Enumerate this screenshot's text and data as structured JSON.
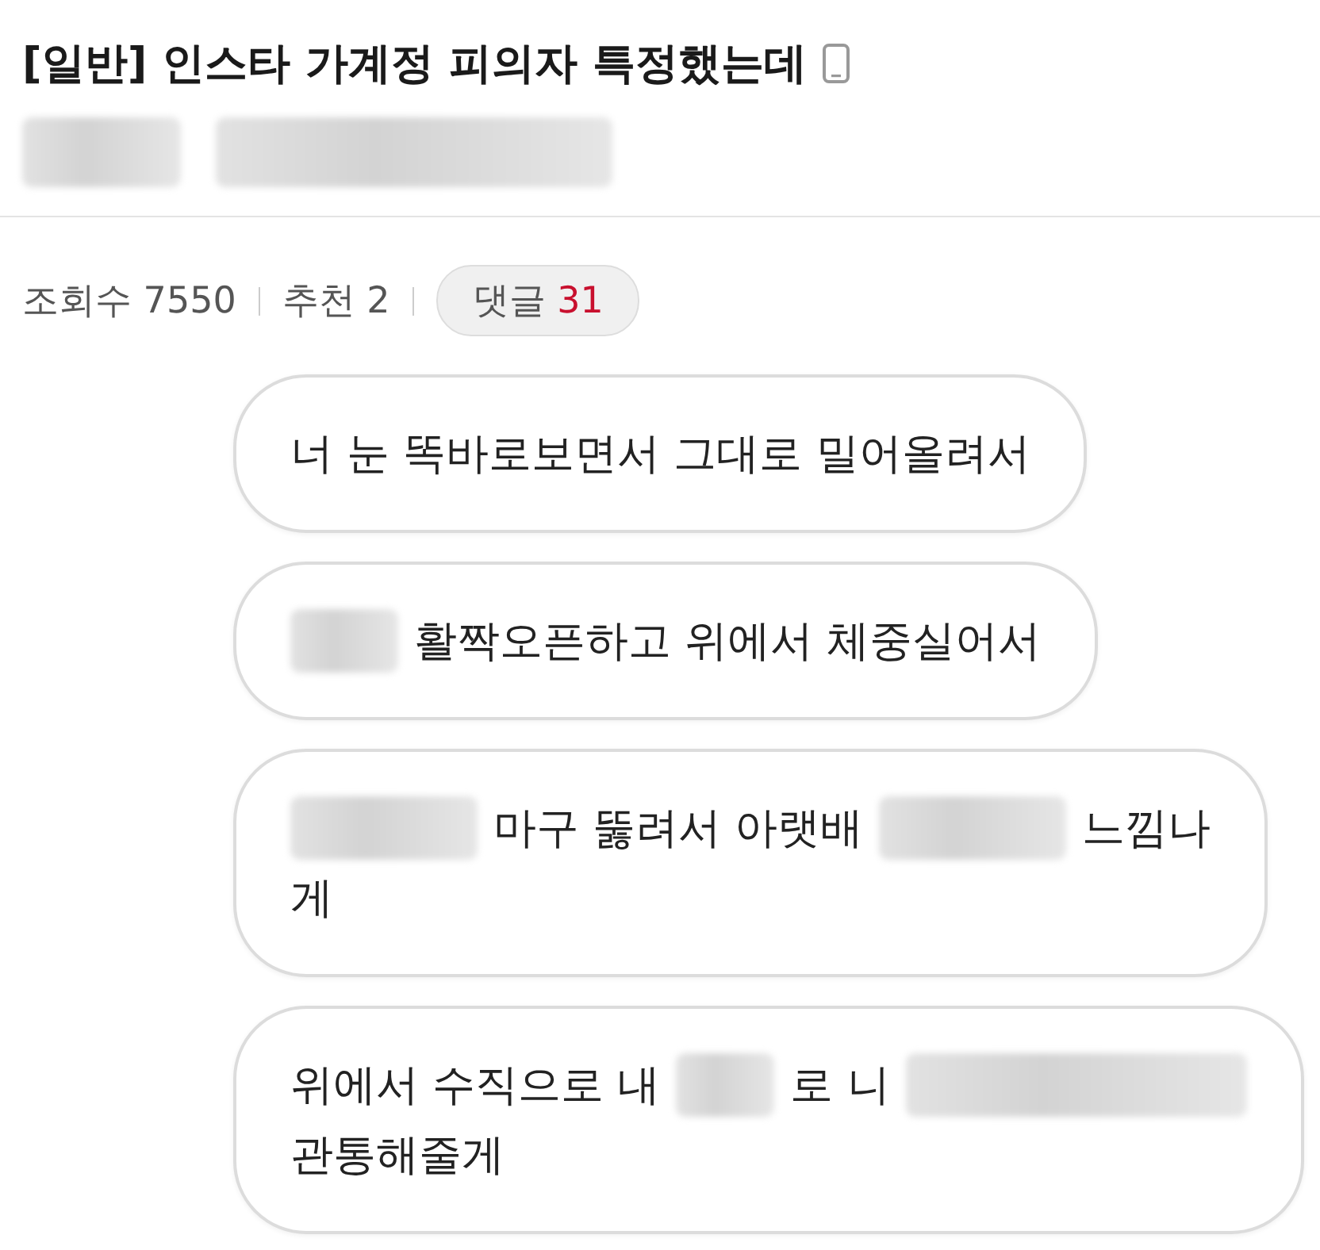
{
  "post": {
    "category": "[일반]",
    "title": "인스타 가계정 피의자 특정했는데"
  },
  "stats": {
    "views_label": "조회수",
    "views": "7550",
    "likes_label": "추천",
    "likes": "2",
    "comments_label": "댓글",
    "comments": "31"
  },
  "messages": [
    {
      "lines": [
        [
          {
            "kind": "text",
            "text": "너 눈 똑바로보면서 그대로 밀어올려서"
          }
        ]
      ]
    },
    {
      "lines": [
        [
          {
            "kind": "redacted_short"
          },
          {
            "kind": "text",
            "text": "활짝오픈하고 위에서 체중실어서"
          }
        ]
      ]
    },
    {
      "lines": [
        [
          {
            "kind": "redacted_long"
          },
          {
            "kind": "text",
            "text": "마구 뚫려서 아랫배"
          },
          {
            "kind": "redacted_long"
          },
          {
            "kind": "text",
            "text": "느낌나"
          }
        ],
        [
          {
            "kind": "text",
            "text": "게"
          }
        ]
      ]
    },
    {
      "lines": [
        [
          {
            "kind": "text",
            "text": "위에서 수직으로 내"
          },
          {
            "kind": "redacted_medium"
          },
          {
            "kind": "text",
            "text": "로 니"
          },
          {
            "kind": "redacted_wide"
          }
        ],
        [
          {
            "kind": "text",
            "text": "관통해줄게"
          }
        ]
      ]
    }
  ]
}
